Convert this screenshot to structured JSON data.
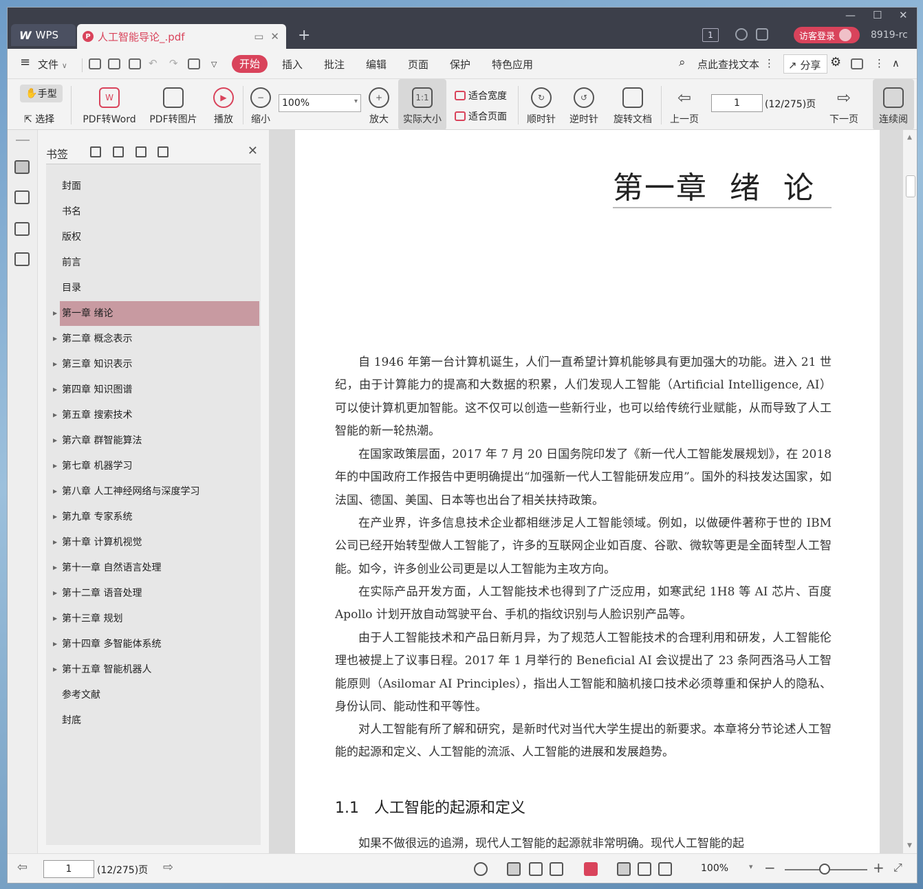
{
  "titlebar": {
    "app_tab": "WPS",
    "app_logo": "W",
    "doc_tab": "人工智能导论_.pdf",
    "doc_icon": "P",
    "new_tab": "+",
    "badge": "1",
    "login": "访客登录",
    "user_id": "8919-rc",
    "min": "—",
    "max": "☐",
    "close": "✕"
  },
  "menubar": {
    "menu_icon": "≡",
    "file": "文件",
    "start": "开始",
    "insert": "插入",
    "annotate": "批注",
    "edit": "编辑",
    "page": "页面",
    "protect": "保护",
    "special": "特色应用",
    "search": "点此查找文本",
    "share": "分享"
  },
  "toolbar": {
    "hand": "手型",
    "select": "选择",
    "pdf_to_word": "PDF转Word",
    "pdf_to_image": "PDF转图片",
    "play": "播放",
    "zoom_out": "缩小",
    "zoom_value": "100%",
    "zoom_in": "放大",
    "actual_size": "实际大小",
    "actual_size_icon": "1:1",
    "fit_width": "适合宽度",
    "fit_page": "适合页面",
    "rotate_cw": "顺时针",
    "rotate_ccw": "逆时针",
    "rotate_doc": "旋转文档",
    "prev_page": "上一页",
    "page_input": "1",
    "page_total": "(12/275)页",
    "next_page": "下一页",
    "continuous": "连续阅"
  },
  "bookmarks": {
    "title": "书签",
    "items": [
      {
        "label": "封面",
        "expandable": false
      },
      {
        "label": "书名",
        "expandable": false
      },
      {
        "label": "版权",
        "expandable": false
      },
      {
        "label": "前言",
        "expandable": false
      },
      {
        "label": "目录",
        "expandable": false
      },
      {
        "label": "第一章 绪论",
        "expandable": true,
        "selected": true
      },
      {
        "label": "第二章 概念表示",
        "expandable": true
      },
      {
        "label": "第三章 知识表示",
        "expandable": true
      },
      {
        "label": "第四章 知识图谱",
        "expandable": true
      },
      {
        "label": "第五章 搜索技术",
        "expandable": true
      },
      {
        "label": "第六章 群智能算法",
        "expandable": true
      },
      {
        "label": "第七章 机器学习",
        "expandable": true
      },
      {
        "label": "第八章 人工神经网络与深度学习",
        "expandable": true
      },
      {
        "label": "第九章 专家系统",
        "expandable": true
      },
      {
        "label": "第十章 计算机视觉",
        "expandable": true
      },
      {
        "label": "第十一章 自然语言处理",
        "expandable": true
      },
      {
        "label": "第十二章 语音处理",
        "expandable": true
      },
      {
        "label": "第十三章 规划",
        "expandable": true
      },
      {
        "label": "第十四章 多智能体系统",
        "expandable": true
      },
      {
        "label": "第十五章 智能机器人",
        "expandable": true
      },
      {
        "label": "参考文献",
        "expandable": false
      },
      {
        "label": "封底",
        "expandable": false
      }
    ]
  },
  "document": {
    "chapter_title": "第一章  绪  论",
    "paragraphs": [
      "自 1946 年第一台计算机诞生，人们一直希望计算机能够具有更加强大的功能。进入 21 世纪，由于计算能力的提高和大数据的积累，人们发现人工智能（Artificial Intelligence, AI）可以使计算机更加智能。这不仅可以创造一些新行业，也可以给传统行业赋能，从而导致了人工智能的新一轮热潮。",
      "在国家政策层面，2017 年 7 月 20 日国务院印发了《新一代人工智能发展规划》，在 2018 年的中国政府工作报告中更明确提出“加强新一代人工智能研发应用”。国外的科技发达国家，如法国、德国、美国、日本等也出台了相关扶持政策。",
      "在产业界，许多信息技术企业都相继涉足人工智能领域。例如，以做硬件著称于世的 IBM 公司已经开始转型做人工智能了，许多的互联网企业如百度、谷歌、微软等更是全面转型人工智能。如今，许多创业公司更是以人工智能为主攻方向。",
      "在实际产品开发方面，人工智能技术也得到了广泛应用，如寒武纪 1H8 等 AI 芯片、百度 Apollo 计划开放自动驾驶平台、手机的指纹识别与人脸识别产品等。",
      "由于人工智能技术和产品日新月异，为了规范人工智能技术的合理利用和研发，人工智能伦理也被提上了议事日程。2017 年 1 月举行的 Beneficial AI 会议提出了 23 条阿西洛马人工智能原则（Asilomar AI Principles），指出人工智能和脑机接口技术必须尊重和保护人的隐私、身份认同、能动性和平等性。",
      "对人工智能有所了解和研究，是新时代对当代大学生提出的新要求。本章将分节论述人工智能的起源和定义、人工智能的流派、人工智能的进展和发展趋势。"
    ],
    "section_number": "1.1",
    "section_title": "人工智能的起源和定义",
    "last_line": "如果不做很远的追溯，现代人工智能的起源就非常明确。现代人工智能的起"
  },
  "statusbar": {
    "page_input": "1",
    "page_total": "(12/275)页",
    "zoom": "100%",
    "zoom_level_fraction": 0.5
  },
  "colors": {
    "accent": "#d9435b",
    "selected_bookmark": "#c89aa1",
    "titlebar": "#3c3f4a"
  }
}
